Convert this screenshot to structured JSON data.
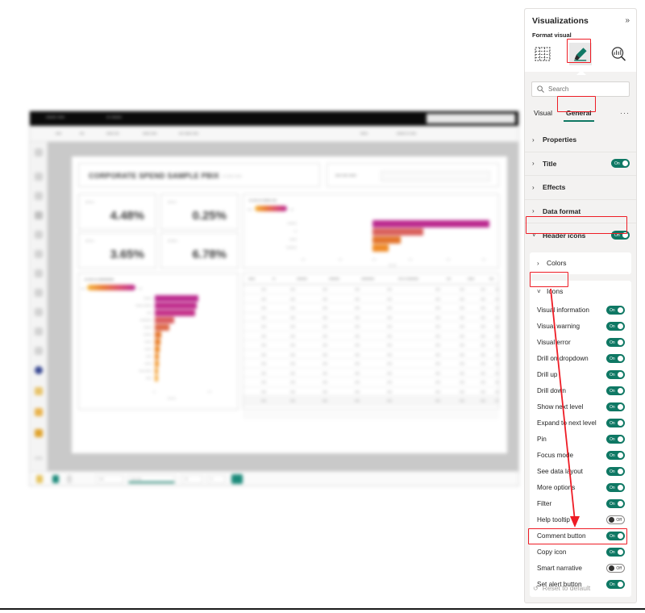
{
  "panel": {
    "title": "Visualizations",
    "expand_icon": "chevron-double-right-icon",
    "format_label": "Format visual",
    "icons": [
      {
        "name": "build-visual-icon",
        "label": "Build visual"
      },
      {
        "name": "format-paintbrush-icon",
        "label": "Format visual"
      },
      {
        "name": "analytics-magnifier-icon",
        "label": "Analytics"
      }
    ],
    "search": {
      "placeholder": "Search",
      "value": "",
      "icon": "search-icon"
    },
    "tabs": [
      {
        "label": "Visual",
        "active": false
      },
      {
        "label": "General",
        "active": true
      }
    ],
    "tab_more": "···",
    "reset": {
      "label": "Reset to default",
      "icon": "reset-icon"
    }
  },
  "sections": [
    {
      "name": "Properties",
      "expanded": false,
      "toggle": null
    },
    {
      "name": "Title",
      "expanded": false,
      "toggle": "On"
    },
    {
      "name": "Effects",
      "expanded": false,
      "toggle": null
    },
    {
      "name": "Data format",
      "expanded": false,
      "toggle": null
    },
    {
      "name": "Header icons",
      "expanded": true,
      "toggle": "On",
      "highlighted": true
    }
  ],
  "subsections": [
    {
      "name": "Colors",
      "expanded": false
    },
    {
      "name": "Icons",
      "expanded": true,
      "highlighted": true
    }
  ],
  "icon_options": [
    {
      "label": "Visual information",
      "state": "On"
    },
    {
      "label": "Visual warning",
      "state": "On"
    },
    {
      "label": "Visual error",
      "state": "On"
    },
    {
      "label": "Drill on dropdown",
      "state": "On"
    },
    {
      "label": "Drill up",
      "state": "On"
    },
    {
      "label": "Drill down",
      "state": "On"
    },
    {
      "label": "Show next level",
      "state": "On"
    },
    {
      "label": "Expand to next level",
      "state": "On"
    },
    {
      "label": "Pin",
      "state": "On"
    },
    {
      "label": "Focus mode",
      "state": "On"
    },
    {
      "label": "See data layout",
      "state": "On"
    },
    {
      "label": "More options",
      "state": "On"
    },
    {
      "label": "Filter",
      "state": "On"
    },
    {
      "label": "Help tooltip",
      "state": "Off"
    },
    {
      "label": "Comment button",
      "state": "On"
    },
    {
      "label": "Copy icon",
      "state": "On",
      "highlighted": true
    },
    {
      "label": "Smart narrative",
      "state": "Off"
    },
    {
      "label": "Set alert button",
      "state": "On"
    }
  ],
  "annotation": {
    "color": "#ee1c25",
    "arrow_from": "Icons",
    "arrow_to": "Copy icon"
  },
  "report": {
    "blurred": true,
    "window_title": "",
    "header_card_title": "CORPORATE SPEND SAMPLE PBIX",
    "kpis": [
      {
        "label": "",
        "value": "4.48%"
      },
      {
        "label": "",
        "value": "0.25%"
      },
      {
        "label": "",
        "value": "3.65%"
      },
      {
        "label": "",
        "value": "6.78%"
      }
    ],
    "charts": [
      {
        "title": "",
        "type": "bar",
        "bars": [
          88,
          38,
          22,
          12
        ]
      },
      {
        "title": "",
        "type": "bar",
        "bars": [
          72,
          70,
          68,
          26,
          20,
          10,
          9,
          8,
          7,
          6,
          5,
          4
        ]
      }
    ],
    "table": {
      "columns": 10,
      "rows": 13
    },
    "page_tabs": [
      "",
      "",
      "",
      ""
    ]
  },
  "colors": {
    "accent_teal": "#0f7864",
    "annotation_red": "#ee1c25",
    "panel_bg": "#f3f2f1",
    "card_bg": "#ffffff"
  }
}
